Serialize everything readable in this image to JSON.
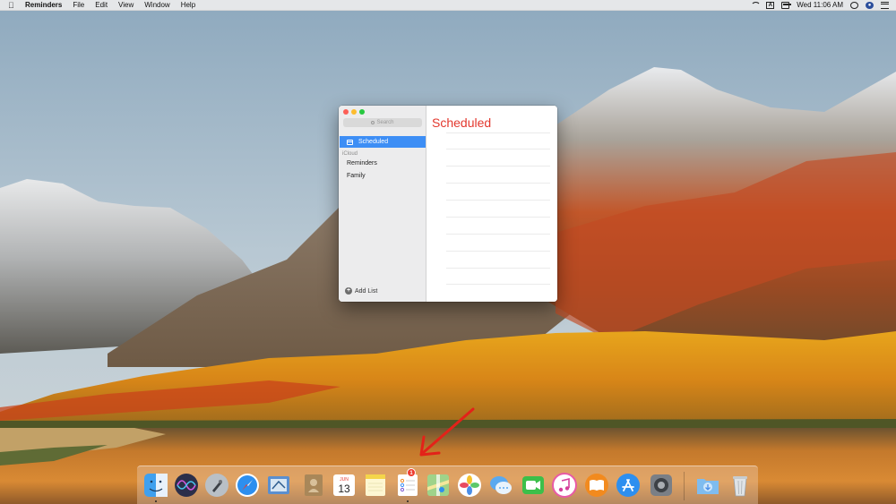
{
  "menubar": {
    "app_name": "Reminders",
    "menus": [
      "File",
      "Edit",
      "View",
      "Window",
      "Help"
    ],
    "clock": "Wed 11:06 AM",
    "input_source": "A"
  },
  "window": {
    "search_placeholder": "Search",
    "sidebar": {
      "smart_list": "Scheduled",
      "section_label": "iCloud",
      "lists": [
        "Reminders",
        "Family"
      ],
      "add_list_label": "Add List"
    },
    "main": {
      "title": "Scheduled",
      "title_color": "#e3382e"
    }
  },
  "dock": {
    "apps": [
      {
        "name": "Finder",
        "icon": "finder-icon",
        "running": true
      },
      {
        "name": "Siri",
        "icon": "siri-icon",
        "running": false
      },
      {
        "name": "Launchpad",
        "icon": "launchpad-icon",
        "running": false
      },
      {
        "name": "Safari",
        "icon": "safari-icon",
        "running": false
      },
      {
        "name": "Mail",
        "icon": "mail-icon",
        "running": false
      },
      {
        "name": "Contacts",
        "icon": "contacts-icon",
        "running": false
      },
      {
        "name": "Calendar",
        "icon": "calendar-icon",
        "running": false,
        "month": "JUN",
        "day": "13"
      },
      {
        "name": "Notes",
        "icon": "notes-icon",
        "running": false
      },
      {
        "name": "Reminders",
        "icon": "reminders-icon",
        "running": true,
        "badge": "1"
      },
      {
        "name": "Maps",
        "icon": "maps-icon",
        "running": false
      },
      {
        "name": "Photos",
        "icon": "photos-icon",
        "running": false
      },
      {
        "name": "Messages",
        "icon": "messages-icon",
        "running": false
      },
      {
        "name": "FaceTime",
        "icon": "facetime-icon",
        "running": false
      },
      {
        "name": "iTunes",
        "icon": "itunes-icon",
        "running": false
      },
      {
        "name": "iBooks",
        "icon": "ibooks-icon",
        "running": false
      },
      {
        "name": "App Store",
        "icon": "app-store-icon",
        "running": false
      },
      {
        "name": "System Preferences",
        "icon": "system-preferences-icon",
        "running": false
      },
      {
        "name": "Downloads",
        "icon": "downloads-folder-icon",
        "running": false
      },
      {
        "name": "Trash",
        "icon": "trash-icon",
        "running": false
      }
    ]
  },
  "annotation": {
    "arrow_color": "#e32219"
  }
}
